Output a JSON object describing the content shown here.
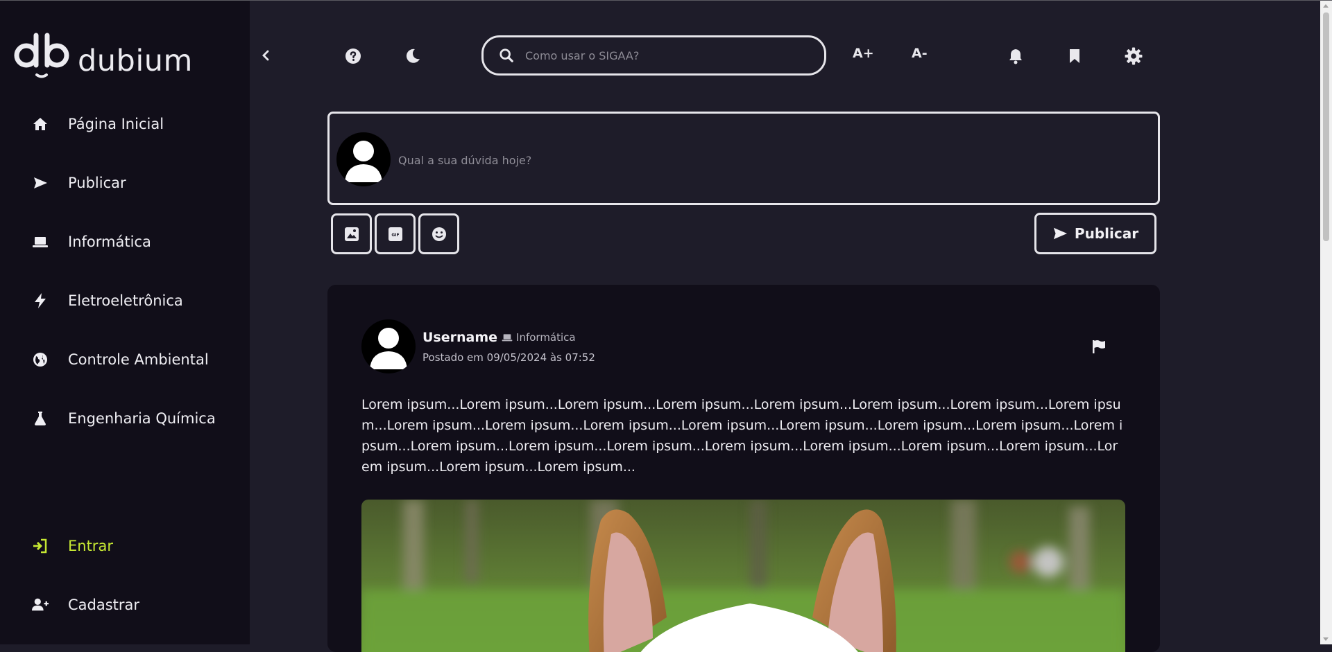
{
  "app": {
    "name": "dubium"
  },
  "sidebar": {
    "items": [
      {
        "label": "Página Inicial",
        "icon": "home-icon"
      },
      {
        "label": "Publicar",
        "icon": "send-icon"
      },
      {
        "label": "Informática",
        "icon": "laptop-icon"
      },
      {
        "label": "Eletroeletrônica",
        "icon": "bolt-icon"
      },
      {
        "label": "Controle Ambiental",
        "icon": "globe-icon"
      },
      {
        "label": "Engenharia Química",
        "icon": "flask-icon"
      }
    ],
    "auth": [
      {
        "label": "Entrar",
        "icon": "sign-in-icon"
      },
      {
        "label": "Cadastrar",
        "icon": "user-plus-icon"
      }
    ],
    "accent_color": "#c6e833"
  },
  "topbar": {
    "search_placeholder": "Como usar o SIGAA?",
    "font_increase": "A+",
    "font_decrease": "A-"
  },
  "composer": {
    "placeholder": "Qual a sua dúvida hoje?",
    "publish_label": "Publicar"
  },
  "post": {
    "username": "Username",
    "category": "Informática",
    "date": "Postado em 09/05/2024 às 07:52",
    "body": "Lorem ipsum...Lorem ipsum...Lorem ipsum...Lorem ipsum...Lorem ipsum...Lorem ipsum...Lorem ipsum...Lorem ipsum...Lorem ipsum...Lorem ipsum...Lorem ipsum...Lorem ipsum...Lorem ipsum...Lorem ipsum...Lorem ipsum...Lorem ipsum...Lorem ipsum...Lorem ipsum...Lorem ipsum...Lorem ipsum...Lorem ipsum...Lorem ipsum...Lorem ipsum...Lorem ipsum...Lorem ipsum...Lorem ipsum..."
  },
  "colors": {
    "background": "#1e1c29",
    "sidebar": "#110e19",
    "accent": "#c6e833"
  }
}
